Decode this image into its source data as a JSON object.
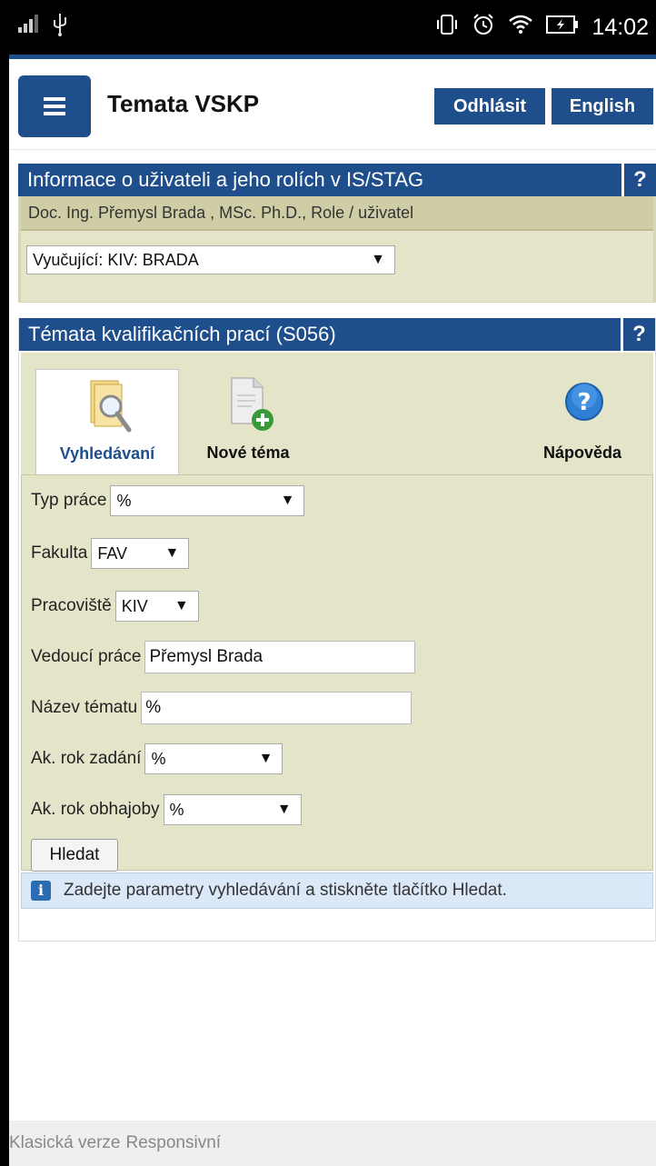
{
  "status_bar": {
    "time": "14:02"
  },
  "header": {
    "title": "Temata VSKP",
    "logout_label": "Odhlásit",
    "language_label": "English"
  },
  "user_panel": {
    "title": "Informace o uživateli a jeho rolích v IS/STAG",
    "help_label": "?",
    "user_line": "Doc. Ing. Přemysl Brada , MSc. Ph.D., Role / uživatel",
    "role_selected": "Vyučující: KIV: BRADA"
  },
  "topics_panel": {
    "title": "Témata kvalifikačních prací (S056)",
    "help_label": "?",
    "tabs": [
      {
        "label": "Vyhledávaní",
        "icon": "search-folder-icon"
      },
      {
        "label": "Nové téma",
        "icon": "new-document-icon"
      },
      {
        "label": "Nápověda",
        "icon": "help-icon"
      }
    ],
    "form": {
      "typ_prace": {
        "label": "Typ práce",
        "value": "%"
      },
      "fakulta": {
        "label": "Fakulta",
        "value": "FAV"
      },
      "pracoviste": {
        "label": "Pracoviště",
        "value": "KIV"
      },
      "vedouci": {
        "label": "Vedoucí práce",
        "value": "Přemysl Brada"
      },
      "nazev": {
        "label": "Název tématu",
        "value": "%"
      },
      "rok_zadani": {
        "label": "Ak. rok zadání",
        "value": "%"
      },
      "rok_obhajoby": {
        "label": "Ak. rok obhajoby",
        "value": "%"
      },
      "search_label": "Hledat"
    },
    "info_text": "Zadejte parametry vyhledávání a stiskněte tlačítko Hledat."
  },
  "footer": {
    "classic_label": "Klasická verze",
    "responsive_label": "Responsivní"
  },
  "colors": {
    "accent": "#1f4e8c",
    "panel_bg": "#e4e4c9",
    "info_bg": "#dbe8f7"
  }
}
